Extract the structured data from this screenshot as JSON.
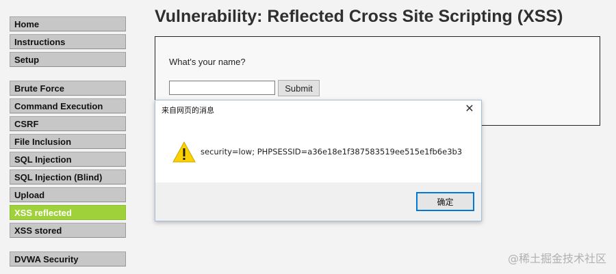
{
  "sidebar": {
    "groups": [
      {
        "items": [
          {
            "label": "Home"
          },
          {
            "label": "Instructions"
          },
          {
            "label": "Setup"
          }
        ]
      },
      {
        "items": [
          {
            "label": "Brute Force"
          },
          {
            "label": "Command Execution"
          },
          {
            "label": "CSRF"
          },
          {
            "label": "File Inclusion"
          },
          {
            "label": "SQL Injection"
          },
          {
            "label": "SQL Injection (Blind)"
          },
          {
            "label": "Upload"
          },
          {
            "label": "XSS reflected",
            "selected": true
          },
          {
            "label": "XSS stored"
          }
        ]
      },
      {
        "items": [
          {
            "label": "DVWA Security"
          }
        ]
      }
    ],
    "selected_color": "#9fd13a",
    "item_color": "#c7c7c7"
  },
  "main": {
    "title": "Vulnerability: Reflected Cross Site Scripting (XSS)",
    "form": {
      "label": "What's your name?",
      "name_value": "",
      "submit_label": "Submit"
    }
  },
  "dialog": {
    "title": "来自网页的消息",
    "close_icon": "close-icon",
    "warning_icon": "warning-icon",
    "message": "security=low; PHPSESSID=a36e18e1f387583519ee515e1fb6e3b3",
    "ok_label": "确定",
    "accent_color": "#0078d7"
  },
  "watermark": {
    "text": "@稀土掘金技术社区"
  }
}
